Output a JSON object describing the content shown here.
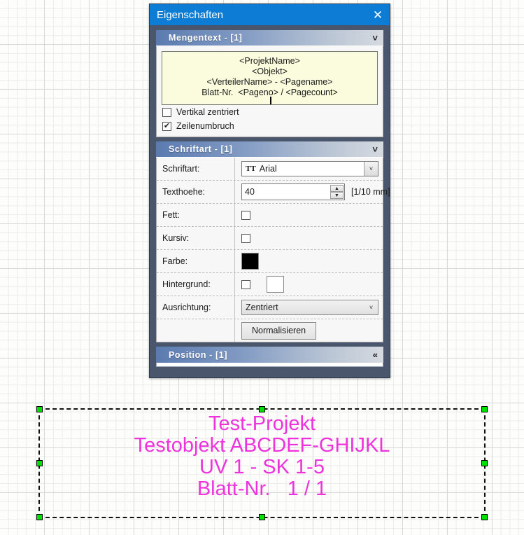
{
  "canvas": {
    "object_text_lines": [
      "Test-Projekt",
      "Testobjekt ABCDEF-GHIJKL",
      "UV 1 - SK 1-5",
      "Blatt-Nr.   1 / 1"
    ],
    "object_text": "Test-Projekt\nTestobjekt ABCDEF-GHIJKL\nUV 1 - SK 1-5\nBlatt-Nr.   1 / 1",
    "text_color": "#ee33dd",
    "handle_color": "#00e000"
  },
  "dialog": {
    "title": "Eigenschaften",
    "close_label": "✕",
    "titlebar_color": "#0c7cd5",
    "sections": {
      "mengentext": {
        "header": "Mengentext  -  [1]",
        "chevron": "˅",
        "preview_text": "<ProjektName>\n<Objekt>\n<VerteilerName> - <Pagename>\nBlatt-Nr.  <Pageno> / <Pagecount>",
        "preview_bg": "#fbfbdd",
        "checkboxes": [
          {
            "label": "Vertikal zentriert",
            "checked": false
          },
          {
            "label": "Zeilenumbruch",
            "checked": true
          }
        ]
      },
      "schriftart": {
        "header": "Schriftart  -  [1]",
        "chevron": "˅",
        "rows": {
          "font": {
            "label": "Schriftart:",
            "value": "Arial",
            "icon": "truetype-icon",
            "icon_glyph": "TT",
            "arrow": "˅"
          },
          "textheight": {
            "label": "Texthoehe:",
            "value": "40",
            "unit": "[1/10 mm]",
            "spin_up": "▲",
            "spin_down": "▼"
          },
          "bold": {
            "label": "Fett:",
            "checked": false
          },
          "italic": {
            "label": "Kursiv:",
            "checked": false
          },
          "color": {
            "label": "Farbe:",
            "value": "#000000"
          },
          "background": {
            "label": "Hintergrund:",
            "checked": false,
            "value": "#ffffff"
          },
          "alignment": {
            "label": "Ausrichtung:",
            "value": "Zentriert",
            "arrow": "˅"
          },
          "normalize": {
            "label": "Normalisieren"
          }
        }
      },
      "position": {
        "header": "Position  -  [1]",
        "chevron": "«"
      }
    }
  }
}
